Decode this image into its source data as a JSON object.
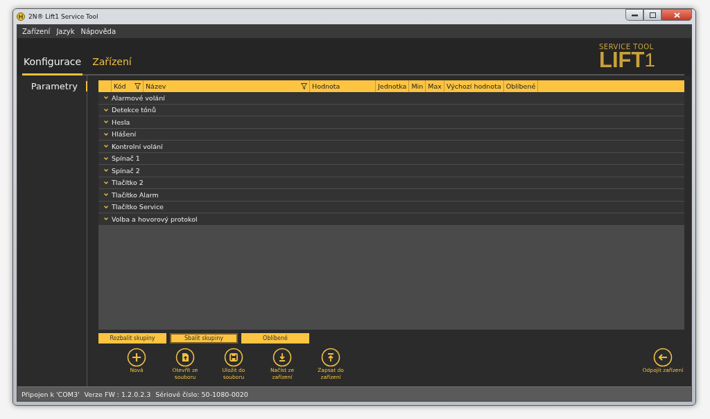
{
  "window": {
    "title": "2N® Lift1 Service Tool"
  },
  "menu": [
    "Zařízení",
    "Jazyk",
    "Nápověda"
  ],
  "tabs": [
    {
      "label": "Konfigurace",
      "selected": true
    },
    {
      "label": "Zařízení",
      "selected": false
    }
  ],
  "logo": {
    "subtitle": "SERVICE TOOL",
    "name": "LIFT",
    "number": "1"
  },
  "sidebar": {
    "items": [
      {
        "label": "Parametry",
        "selected": true
      }
    ]
  },
  "table": {
    "columns": [
      {
        "label": "Kód",
        "filter": true
      },
      {
        "label": "Název",
        "filter": true
      },
      {
        "label": "Hodnota",
        "filter": false
      },
      {
        "label": "Jednotka",
        "filter": false
      },
      {
        "label": "Min",
        "filter": false
      },
      {
        "label": "Max",
        "filter": false
      },
      {
        "label": "Výchozí hodnota",
        "filter": false
      },
      {
        "label": "Oblíbené",
        "filter": false
      }
    ],
    "groups": [
      {
        "label": "Alarmové volání",
        "expanded": false
      },
      {
        "label": "Detekce tónů",
        "expanded": false
      },
      {
        "label": "Hesla",
        "expanded": false
      },
      {
        "label": "Hlášení",
        "expanded": false
      },
      {
        "label": "Kontrolní volání",
        "expanded": false
      },
      {
        "label": "Spínač 1",
        "expanded": false
      },
      {
        "label": "Spínač 2",
        "expanded": false
      },
      {
        "label": "Tlačítko 2",
        "expanded": false
      },
      {
        "label": "Tlačítko Alarm",
        "expanded": false
      },
      {
        "label": "Tlačítko Service",
        "expanded": false
      },
      {
        "label": "Volba a hovorový protokol",
        "expanded": false
      }
    ]
  },
  "buttons": [
    {
      "label": "Rozbalit skupiny",
      "focused": false
    },
    {
      "label": "Sbalit skupiny",
      "focused": true
    },
    {
      "label": "Oblíbené",
      "focused": false
    }
  ],
  "actions": [
    {
      "kind": "new",
      "label": "Nová"
    },
    {
      "kind": "open",
      "label": "Otevřít ze souboru"
    },
    {
      "kind": "save",
      "label": "Uložit do souboru"
    },
    {
      "kind": "read",
      "label": "Načíst ze zařízení"
    },
    {
      "kind": "write",
      "label": "Zapsat do zařízení"
    }
  ],
  "disconnect": {
    "kind": "disconnect",
    "label": "Odpojit zařízení"
  },
  "status_bar": [
    "Připojen k 'COM3'",
    "Verze FW : 1.2.0.2.3",
    "Sériové číslo: 50-1080-0020"
  ]
}
